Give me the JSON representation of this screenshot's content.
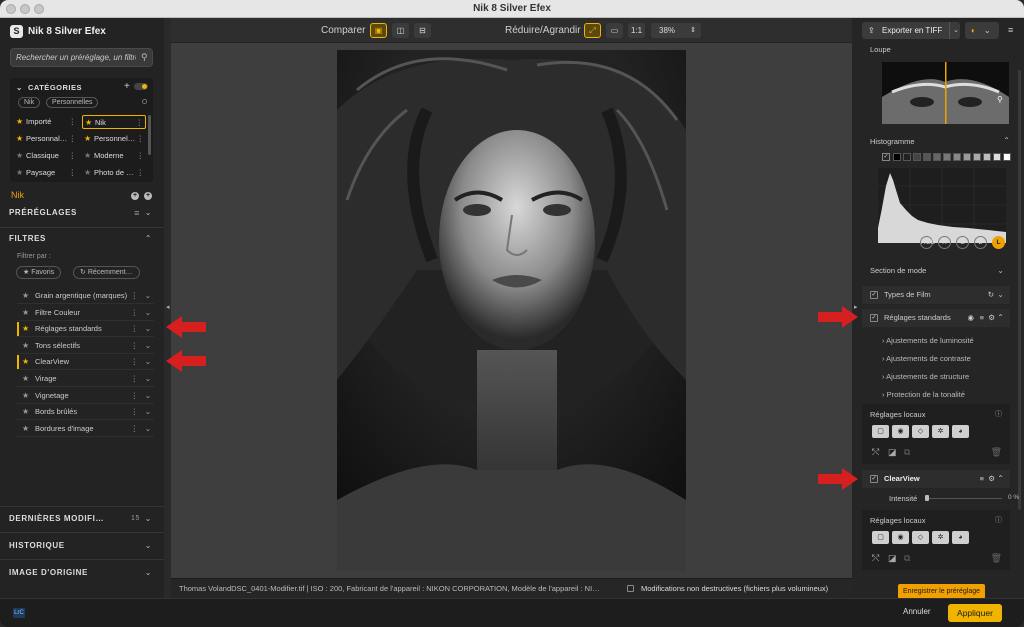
{
  "window": {
    "title": "Nik 8 Silver Efex"
  },
  "left": {
    "app_name": "Nik 8 Silver Efex",
    "search_placeholder": "Rechercher un préréglage, un filtre…",
    "categories": {
      "title": "CATÉGORIES",
      "chips": [
        "Nik",
        "Personnelles"
      ],
      "items": [
        {
          "label": "Importé",
          "starred": true,
          "selected": false
        },
        {
          "label": "Nik",
          "starred": true,
          "selected": true
        },
        {
          "label": "Personnal…",
          "starred": true,
          "selected": false
        },
        {
          "label": "Personnel…",
          "starred": true,
          "selected": false
        },
        {
          "label": "Classique",
          "starred": false,
          "selected": false
        },
        {
          "label": "Moderne",
          "starred": false,
          "selected": false
        },
        {
          "label": "Paysage",
          "starred": false,
          "selected": false
        },
        {
          "label": "Photo de …",
          "starred": false,
          "selected": false
        }
      ]
    },
    "nik_label": "Nik",
    "presets_title": "PRÉRÉGLAGES",
    "filters_title": "FILTRES",
    "filter_by": "Filtrer par :",
    "pills": [
      "Favoris",
      "Récemment…"
    ],
    "filters": [
      {
        "label": "Grain argentique (marques)",
        "fav": false
      },
      {
        "label": "Filtre Couleur",
        "fav": false
      },
      {
        "label": "Réglages standards",
        "fav": true
      },
      {
        "label": "Tons sélectifs",
        "fav": false
      },
      {
        "label": "ClearView",
        "fav": true
      },
      {
        "label": "Virage",
        "fav": false
      },
      {
        "label": "Vignetage",
        "fav": false
      },
      {
        "label": "Bords brûlés",
        "fav": false
      },
      {
        "label": "Bordures d'image",
        "fav": false
      }
    ],
    "recent_title": "DERNIÈRES MODIFI…",
    "recent_count": "15",
    "history_title": "HISTORIQUE",
    "original_title": "IMAGE D'ORIGINE"
  },
  "toolbar": {
    "compare_label": "Comparer",
    "zoom_label": "Réduire/Agrandir",
    "one_to_one": "1:1",
    "zoom_value": "38%"
  },
  "status": {
    "info": "Thomas VolandDSC_0401-Modifier.tif    |    ISO : 200, Fabricant de l'appareil : NIKON CORPORATION, Modèle de l'appareil : NI…",
    "nondestructive": "Modifications non destructives (fichiers plus volumineux)"
  },
  "right": {
    "export_label": "Exporter en TIFF",
    "loupe_title": "Loupe",
    "histogram_title": "Histogramme",
    "channels": [
      "RGB",
      "R",
      "G",
      "B",
      "L"
    ],
    "active_channel": "L",
    "mode_section": "Section de mode",
    "film_types": "Types de Film",
    "standard_settings": "Réglages standards",
    "sub_items": [
      "Ajustements de luminosité",
      "Ajustements de contraste",
      "Ajustements de structure",
      "Protection de la tonalité"
    ],
    "local_settings": "Réglages locaux",
    "clearview": "ClearView",
    "intensity_label": "Intensité",
    "intensity_value": "0 %",
    "local_settings_2": "Réglages locaux",
    "save_preset": "Enregistrer le préréglage"
  },
  "bottom": {
    "lrc": "LrC",
    "cancel": "Annuler",
    "apply": "Appliquer"
  },
  "colors": {
    "accent": "#f0b400",
    "arrow": "#d61f1f"
  }
}
